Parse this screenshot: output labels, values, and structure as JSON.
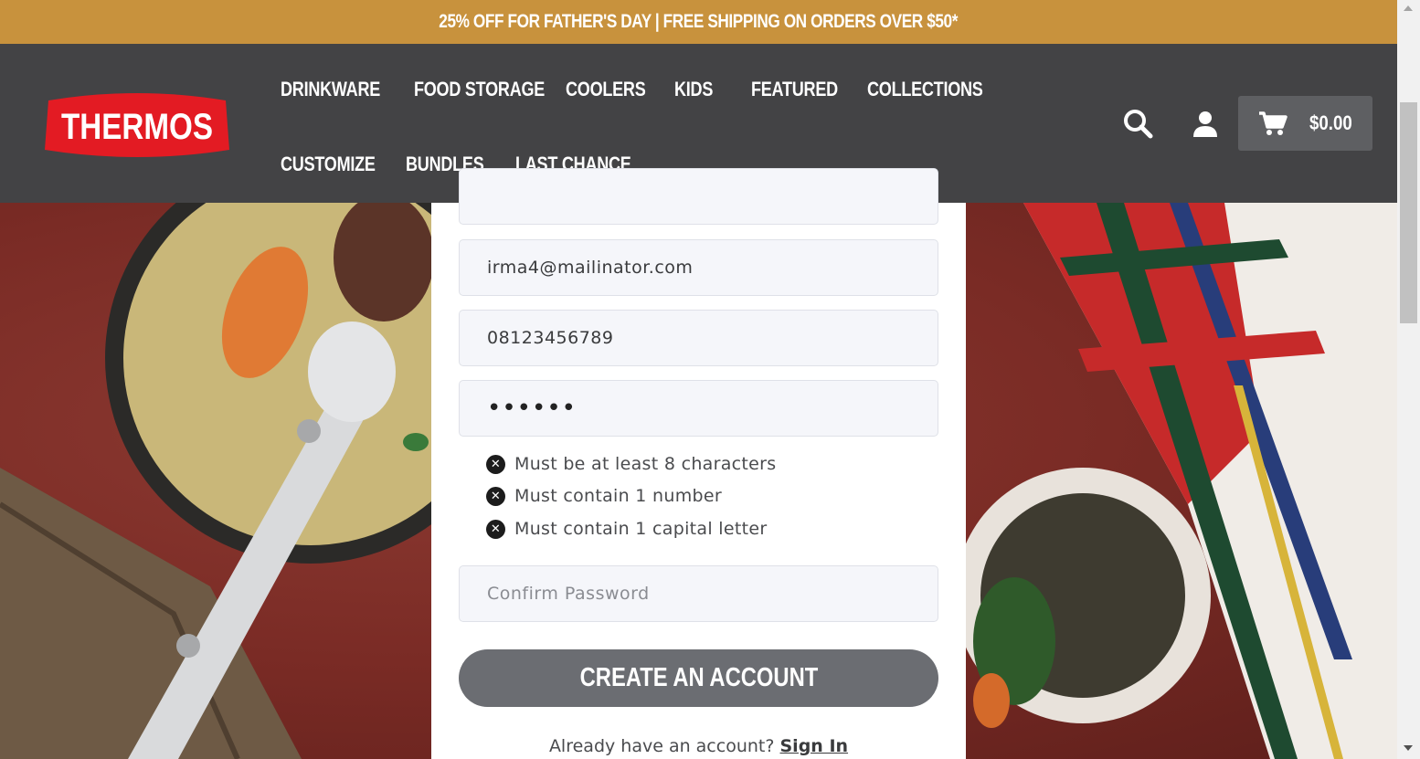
{
  "promo": {
    "text": "25% OFF FOR FATHER'S DAY | FREE SHIPPING ON ORDERS OVER $50*"
  },
  "brand": {
    "logo_text": "THERMOS",
    "logo_color": "#e31b23",
    "promo_color": "#c8923d",
    "header_color": "#434345"
  },
  "nav": {
    "items": [
      {
        "label": "DRINKWARE"
      },
      {
        "label": "FOOD STORAGE"
      },
      {
        "label": "COOLERS"
      },
      {
        "label": "KIDS"
      },
      {
        "label": "FEATURED"
      },
      {
        "label": "COLLECTIONS"
      },
      {
        "label": "CUSTOMIZE"
      },
      {
        "label": "BUNDLES"
      },
      {
        "label": "LAST CHANCE"
      }
    ]
  },
  "header_icons": {
    "search": "search-icon",
    "account": "user-icon",
    "cart": "cart-icon"
  },
  "cart": {
    "total": "$0.00"
  },
  "form": {
    "email_value": "irma4@mailinator.com",
    "phone_value": "08123456789",
    "password_value": "••••••",
    "rules": [
      {
        "text": "Must be at least 8 characters"
      },
      {
        "text": "Must contain 1 number"
      },
      {
        "text": "Must contain 1 capital letter"
      }
    ],
    "confirm_placeholder": "Confirm Password",
    "submit_label": "CREATE AN ACCOUNT",
    "signin_prompt": "Already have an account?",
    "signin_link": "Sign In"
  }
}
